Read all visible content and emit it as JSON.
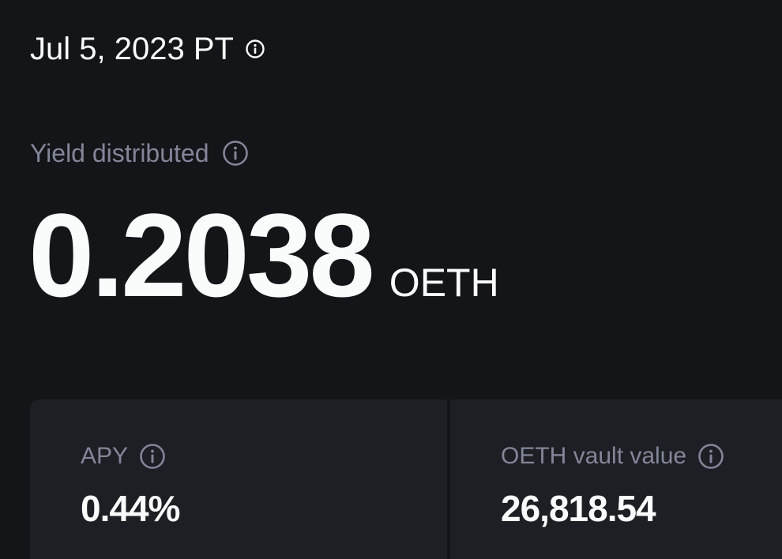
{
  "header": {
    "date": "Jul 5, 2023 PT",
    "date_info_icon": "info-icon"
  },
  "yield": {
    "label": "Yield distributed",
    "label_info_icon": "info-icon",
    "value": "0.2038",
    "unit": "OETH"
  },
  "stats": {
    "apy": {
      "label": "APY",
      "value": "0.44%",
      "info_icon": "info-icon"
    },
    "vault": {
      "label": "OETH vault value",
      "value": "26,818.54",
      "info_icon": "info-icon"
    }
  },
  "colors": {
    "background": "#141519",
    "card": "#1e1f25",
    "text_primary": "#fafbfb",
    "text_secondary": "#828699"
  }
}
